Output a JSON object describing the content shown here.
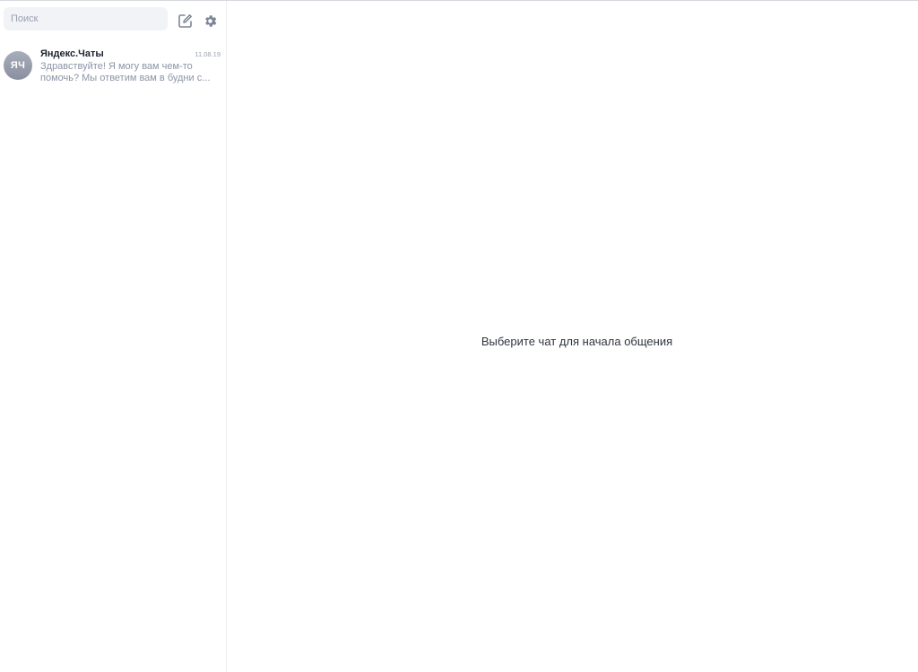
{
  "sidebar": {
    "search": {
      "placeholder": "Поиск"
    },
    "icons": {
      "compose": "compose-icon",
      "settings": "gear-icon"
    },
    "chats": [
      {
        "avatar_initials": "ЯЧ",
        "name": "Яндекс.Чаты",
        "date": "11.08.19",
        "preview_line1": "Здравствуйте! Я могу вам чем-то",
        "preview_line2": "помочь? Мы ответим вам в будни с..."
      }
    ]
  },
  "main": {
    "empty_state_text": "Выберите чат для начала общения"
  },
  "colors": {
    "icon": "#7d8596",
    "search_bg": "#f1f3f6",
    "avatar": "#9a9fae",
    "muted_text": "#8c94a6"
  }
}
